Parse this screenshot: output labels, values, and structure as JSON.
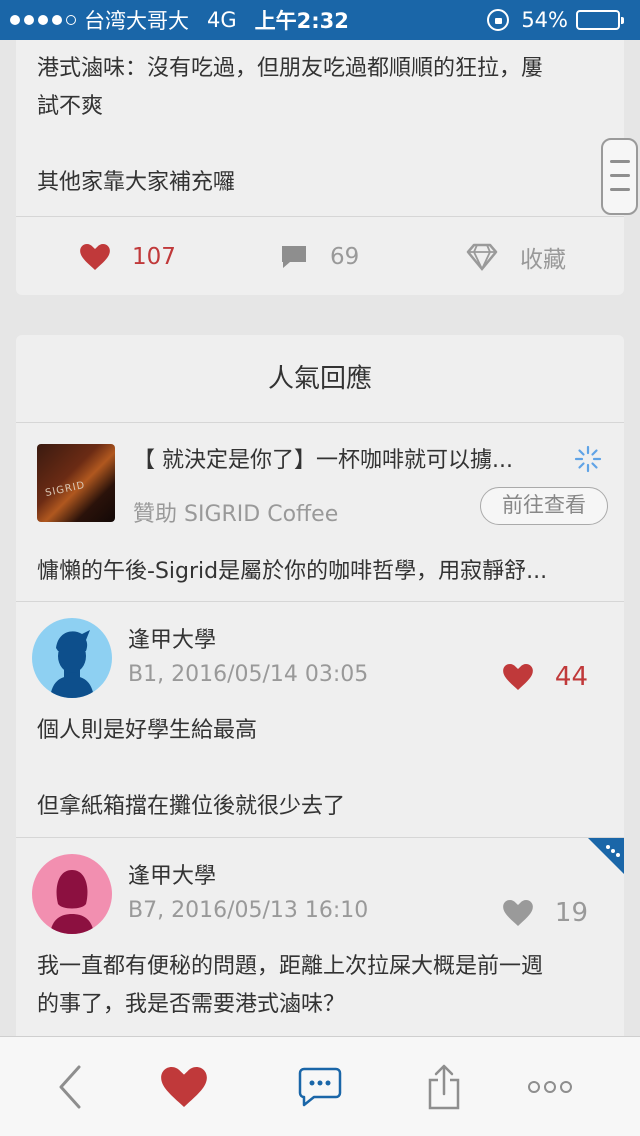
{
  "status_bar": {
    "carrier": "台湾大哥大",
    "network": "4G",
    "time": "上午2:32",
    "battery": "54%",
    "battery_level": 0.54
  },
  "post": {
    "lines": [
      "港式滷味：沒有吃過，但朋友吃過都順順的狂拉，屢",
      "試不爽",
      "其他家靠大家補充囉"
    ],
    "like_count": "107",
    "comment_count": "69",
    "collect_label": "收藏"
  },
  "comments_section": {
    "title": "人氣回應",
    "ad": {
      "title": "【 就決定是你了】一杯咖啡就可以擄...",
      "sponsor": "贊助 SIGRID Coffee",
      "button_label": "前往查看",
      "thumb_text": "SIGRID",
      "description": "慵懶的午後-Sigrid是屬於你的咖啡哲學，用寂靜舒..."
    },
    "comments": [
      {
        "author": "逢甲大學",
        "meta": "B1, 2016/05/14 03:05",
        "likes": "44",
        "liked": true,
        "avatar": "male-avatar",
        "body": [
          "個人則是好學生給最高",
          "但拿紙箱擋在攤位後就很少去了"
        ]
      },
      {
        "author": "逢甲大學",
        "meta": "B7, 2016/05/13 16:10",
        "likes": "19",
        "liked": false,
        "avatar": "female-avatar",
        "body": [
          "我一直都有便秘的問題，距離上次拉屎大概是前一週",
          "的事了，我是否需要港式滷味？"
        ]
      }
    ]
  },
  "toolbar": {
    "icons": [
      "back-icon",
      "heart-icon",
      "comment-icon",
      "share-icon",
      "more-icon"
    ]
  },
  "colors": {
    "status_bar": "#1a66a8",
    "accent_red": "#c0393a",
    "link_blue": "#1a66a8",
    "muted": "#999999"
  }
}
